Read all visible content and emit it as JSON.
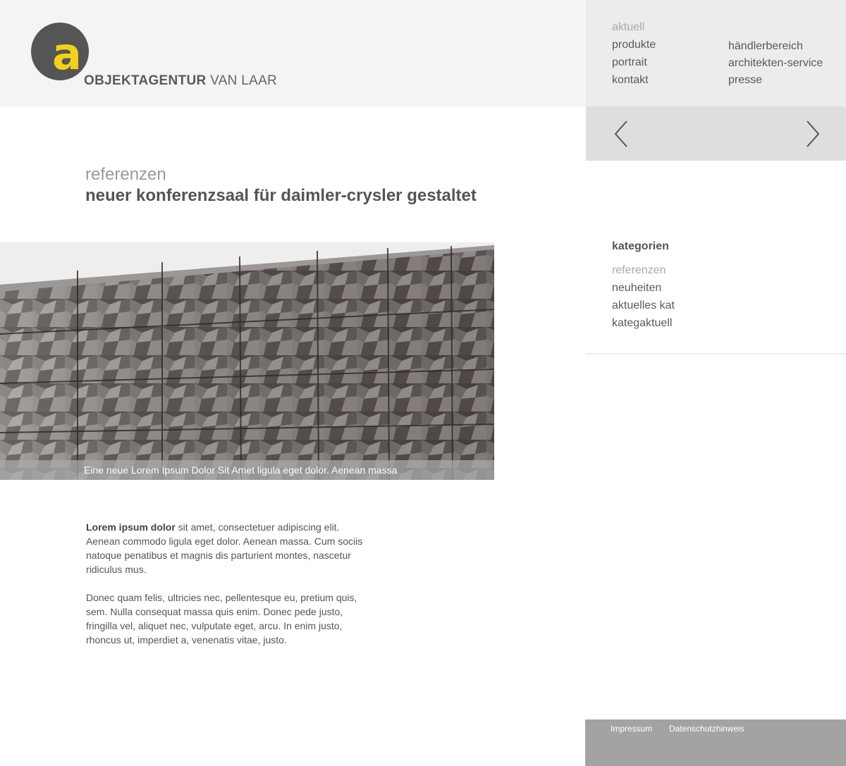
{
  "brand": {
    "logo_letter": "a",
    "name_bold": "OBJEKTAGENTUR",
    "name_regular": "VAN LAAR"
  },
  "nav": {
    "primary": [
      "aktuell",
      "produkte",
      "portrait",
      "kontakt"
    ],
    "secondary": [
      "händlerbereich",
      "architekten-service",
      "presse"
    ],
    "active": "aktuell"
  },
  "slider": {
    "prev_icon": "chevron-left-icon",
    "next_icon": "chevron-right-icon"
  },
  "article": {
    "kicker": "referenzen",
    "title": "neuer konferenzsaal für daimler-crysler gestaltet",
    "image_caption": "Eine neue Lorem Ipsum Dolor Sit Amet ligula eget dolor. Aenean massa",
    "p1_bold": "Lorem ipsum dolor",
    "p1_rest": " sit amet, consectetuer adipiscing elit. Aenean commodo ligula eget dolor. Aenean massa. Cum sociis natoque penatibus et magnis dis parturient montes, nascetur ridiculus mus.",
    "p2": "Donec quam felis, ultricies nec, pellentesque eu, pretium quis, sem. Nulla consequat massa quis enim. Donec pede justo, fringilla vel, aliquet nec, vulputate eget, arcu. In enim justo, rhoncus ut, imperdiet a, venenatis vitae, justo."
  },
  "categories": {
    "title": "kategorien",
    "items": [
      "referenzen",
      "neuheiten",
      "aktuelles kat",
      "kategaktuell"
    ],
    "active": "referenzen"
  },
  "footer": {
    "links": [
      "Impressum",
      "Datenschutzhinweis"
    ]
  },
  "colors": {
    "accent": "#f3d11b",
    "logo_bg": "#555555",
    "header_bg": "#f4f4f4",
    "nav_bg": "#ececec",
    "arrow_bar_bg": "#dedede",
    "footer_bg": "#a3a3a3"
  }
}
